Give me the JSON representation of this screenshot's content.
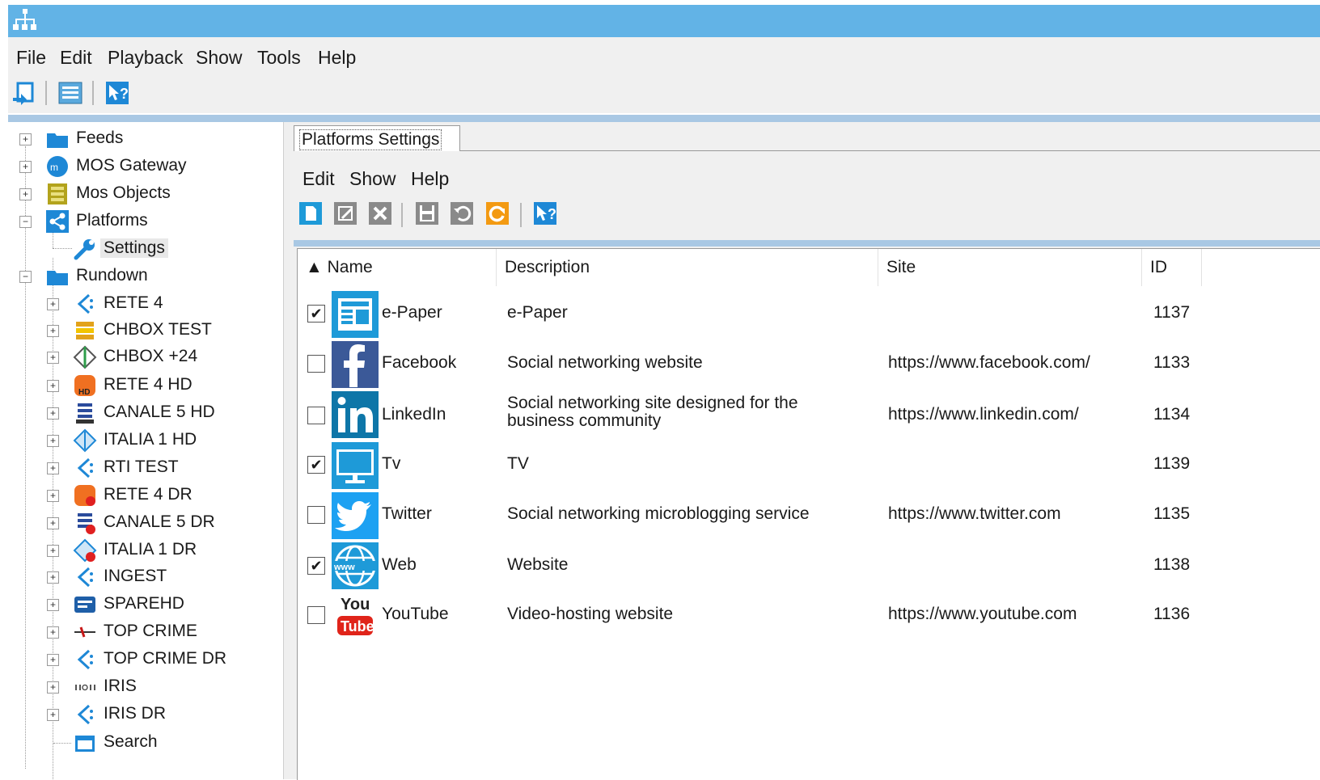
{
  "menubar": [
    "File",
    "Edit",
    "Playback",
    "Show",
    "Tools",
    "Help"
  ],
  "toolbar": {
    "icons": [
      "back-icon",
      "list-icon",
      "help-icon"
    ]
  },
  "tree": [
    {
      "label": "Feeds",
      "icon": "folder-icon"
    },
    {
      "label": "MOS Gateway",
      "icon": "mos-gateway-icon"
    },
    {
      "label": "Mos Objects",
      "icon": "mos-objects-icon"
    },
    {
      "label": "Platforms",
      "icon": "share-icon"
    },
    {
      "label": "Settings",
      "icon": "wrench-icon"
    },
    {
      "label": "Rundown",
      "icon": "folder-icon"
    },
    {
      "label": "RETE 4",
      "icon": "channel-icon"
    },
    {
      "label": "CHBOX TEST",
      "icon": "channel-icon"
    },
    {
      "label": "CHBOX +24",
      "icon": "channel-icon"
    },
    {
      "label": "RETE 4 HD",
      "icon": "channel-icon"
    },
    {
      "label": "CANALE 5 HD",
      "icon": "channel-icon"
    },
    {
      "label": "ITALIA 1 HD",
      "icon": "channel-icon"
    },
    {
      "label": "RTI TEST",
      "icon": "channel-icon"
    },
    {
      "label": "RETE 4 DR",
      "icon": "channel-icon"
    },
    {
      "label": "CANALE 5 DR",
      "icon": "channel-icon"
    },
    {
      "label": "ITALIA 1 DR",
      "icon": "channel-icon"
    },
    {
      "label": "INGEST",
      "icon": "channel-icon"
    },
    {
      "label": "SPAREHD",
      "icon": "channel-icon"
    },
    {
      "label": "TOP CRIME",
      "icon": "channel-icon"
    },
    {
      "label": "TOP CRIME DR",
      "icon": "channel-icon"
    },
    {
      "label": "IRIS",
      "icon": "channel-icon"
    },
    {
      "label": "IRIS DR",
      "icon": "channel-icon"
    },
    {
      "label": "Search",
      "icon": "search-window-icon"
    }
  ],
  "tab_label": "Platforms Settings",
  "inner_menu": [
    "Edit",
    "Show",
    "Help"
  ],
  "inner_toolbar": {
    "icons": [
      "new-icon",
      "edit-icon",
      "delete-icon",
      "save-icon",
      "undo-icon",
      "refresh-icon",
      "help-icon"
    ]
  },
  "grid": {
    "columns": [
      "▲ Name",
      "Description",
      "Site",
      "ID"
    ],
    "rows": [
      {
        "checked": true,
        "icon": "epaper-icon",
        "name": "e-Paper",
        "description": "e-Paper",
        "site": "",
        "id": "1137"
      },
      {
        "checked": false,
        "icon": "facebook-icon",
        "name": "Facebook",
        "description": "Social networking website",
        "site": "https://www.facebook.com/",
        "id": "1133"
      },
      {
        "checked": false,
        "icon": "linkedin-icon",
        "name": "LinkedIn",
        "description": "Social networking site designed for the business community",
        "site": "https://www.linkedin.com/",
        "id": "1134"
      },
      {
        "checked": true,
        "icon": "tv-icon",
        "name": "Tv",
        "description": "TV",
        "site": "",
        "id": "1139"
      },
      {
        "checked": false,
        "icon": "twitter-icon",
        "name": "Twitter",
        "description": "Social networking microblogging service",
        "site": "https://www.twitter.com",
        "id": "1135"
      },
      {
        "checked": true,
        "icon": "web-icon",
        "name": "Web",
        "description": "Website",
        "site": "",
        "id": "1138"
      },
      {
        "checked": false,
        "icon": "youtube-icon",
        "name": "YouTube",
        "description": "Video-hosting website",
        "site": "https://www.youtube.com",
        "id": "1136"
      }
    ]
  },
  "colors": {
    "titlebar": "#62b3e6",
    "accent": "#1e88d6",
    "facebook": "#3b5998",
    "linkedin": "#0e76a8",
    "twitter": "#1da1f2",
    "youtube": "#e0241a"
  }
}
